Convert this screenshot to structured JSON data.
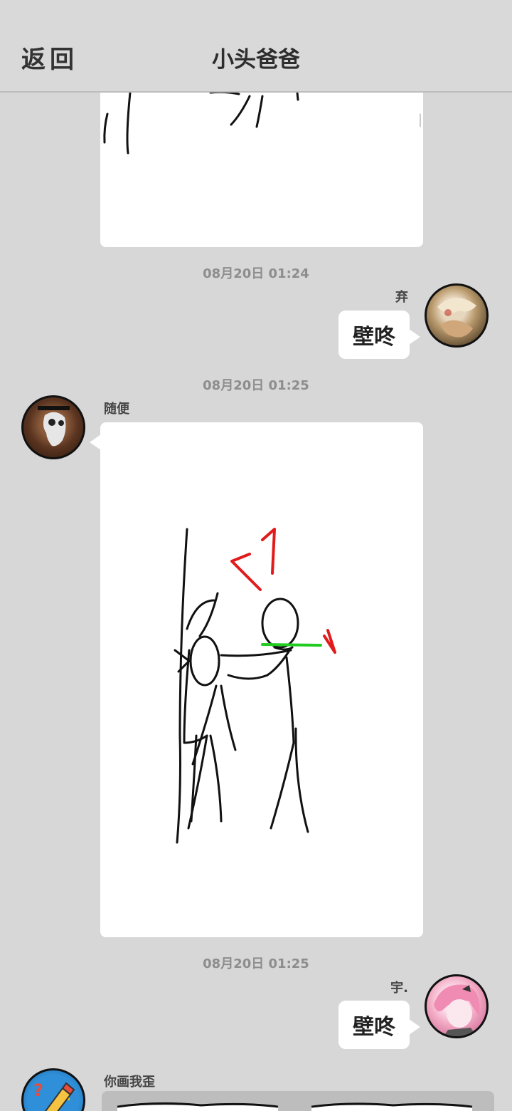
{
  "header": {
    "back_label": "返回",
    "title": "小头爸爸"
  },
  "messages": [
    {
      "type": "timestamp",
      "text": "08月20日  01:24"
    },
    {
      "type": "text",
      "side": "right",
      "sender": "弃",
      "text": "壁咚",
      "avatar": "anime-portrait-avatar"
    },
    {
      "type": "timestamp",
      "text": "08月20日  01:25"
    },
    {
      "type": "drawing",
      "side": "left",
      "sender": "随便",
      "avatar": "plague-doctor-mask-avatar",
      "drawing": "stick-figure-wall-pin-sketch"
    },
    {
      "type": "timestamp",
      "text": "08月20日  01:25"
    },
    {
      "type": "text",
      "side": "right",
      "sender": "宇.",
      "text": "壁咚",
      "avatar": "pink-hair-anime-girl-avatar"
    },
    {
      "type": "drawing",
      "side": "left",
      "sender": "你画我歪",
      "avatar": "pencil-question-mark-avatar",
      "drawing": "partial-sketch"
    }
  ],
  "colors": {
    "background": "#d7d7d7",
    "bubble": "#ffffff",
    "timestamp": "#8d8d8d",
    "sketch_red": "#e11b1b",
    "sketch_green": "#22cc22"
  }
}
